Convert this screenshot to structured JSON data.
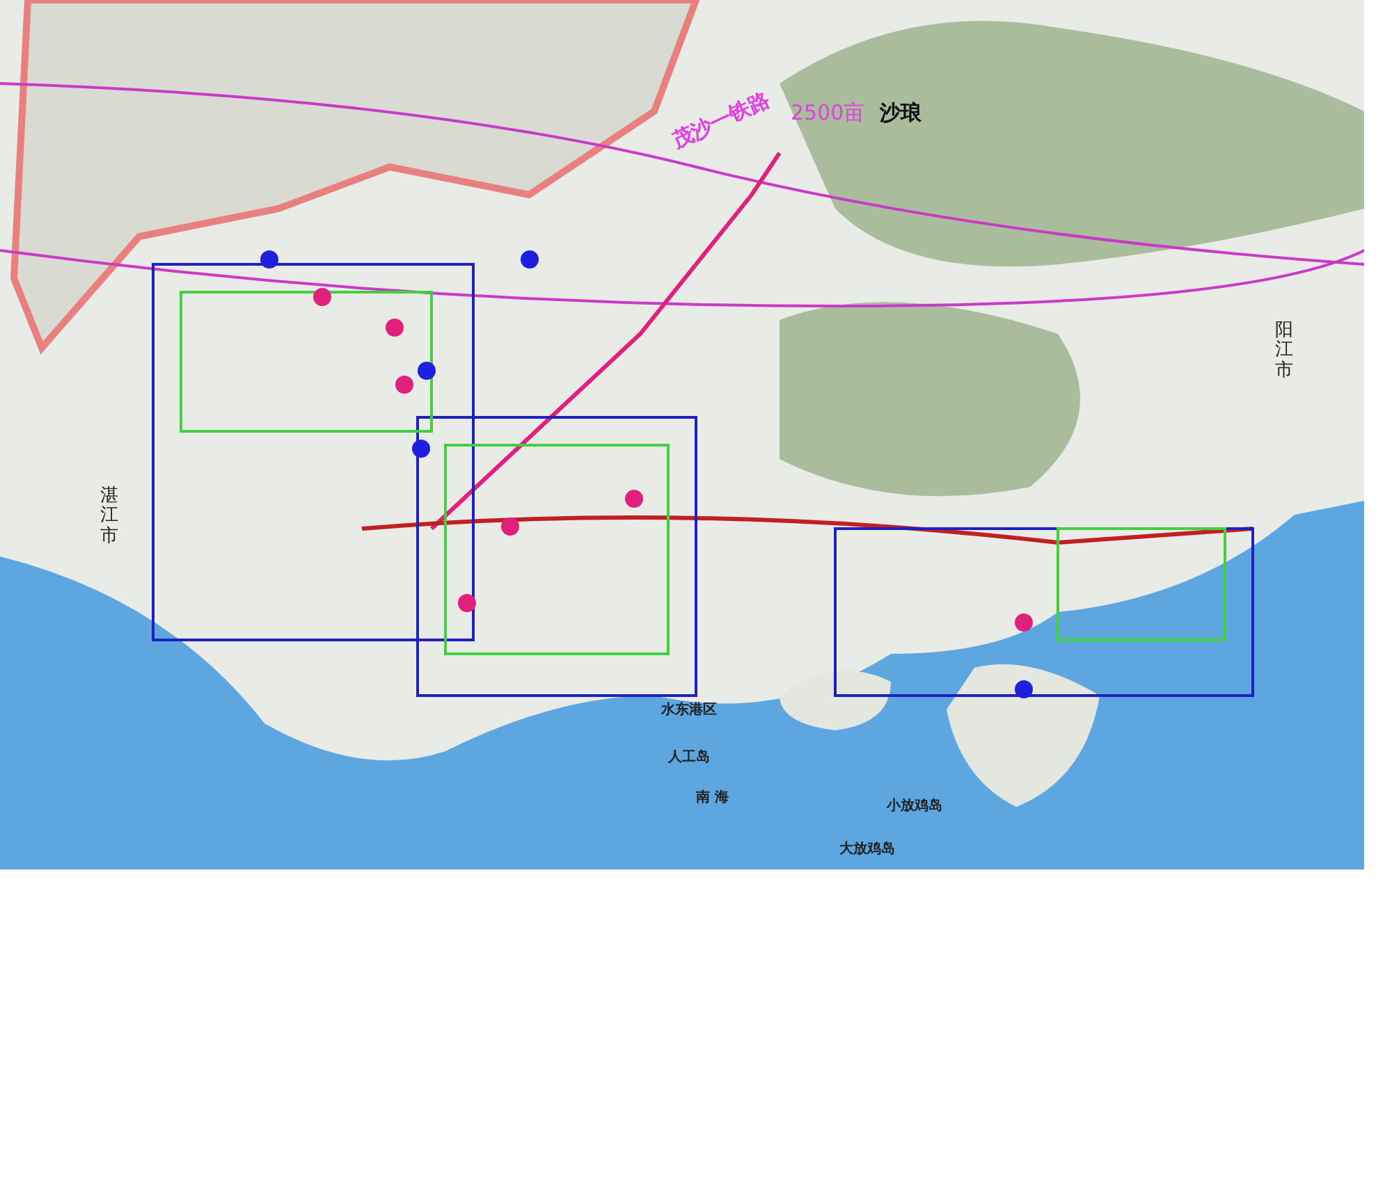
{
  "map": {
    "labels": [
      {
        "text": "茂沙一铁路",
        "kind": "rail"
      },
      {
        "text": "2500亩",
        "kind": "area"
      },
      {
        "text": "沙琅",
        "kind": "town"
      },
      {
        "text": "湛江市",
        "kind": "city"
      },
      {
        "text": "阳江市",
        "kind": "city"
      },
      {
        "text": "水东港区",
        "kind": "place"
      },
      {
        "text": "人工岛",
        "kind": "place"
      },
      {
        "text": "南 海",
        "kind": "sea"
      },
      {
        "text": "小放鸡岛",
        "kind": "place"
      },
      {
        "text": "大放鸡岛",
        "kind": "place"
      }
    ],
    "dots": [
      {
        "color": "#1f1fe0"
      },
      {
        "color": "#e0207a"
      },
      {
        "color": "#e0207a"
      },
      {
        "color": "#1f1fe0"
      },
      {
        "color": "#e0207a"
      },
      {
        "color": "#1f1fe0"
      },
      {
        "color": "#1f1fe0"
      },
      {
        "color": "#e0207a"
      },
      {
        "color": "#e0207a"
      },
      {
        "color": "#e0207a"
      },
      {
        "color": "#e0207a"
      },
      {
        "color": "#1f1fe0"
      }
    ]
  }
}
